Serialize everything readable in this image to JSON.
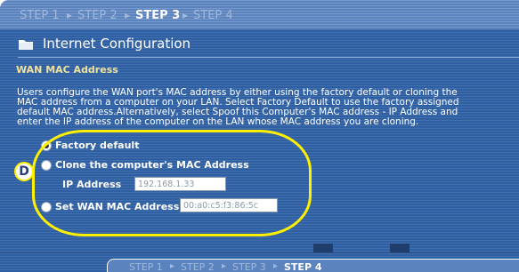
{
  "wizard": {
    "steps": [
      {
        "label": "STEP 1",
        "active": false
      },
      {
        "label": "STEP 2",
        "active": false
      },
      {
        "label": "STEP 3",
        "active": true
      },
      {
        "label": "STEP 4",
        "active": false
      }
    ],
    "separator": "▸"
  },
  "header": {
    "title": "Internet Configuration",
    "icon": "folder-icon"
  },
  "section": {
    "title": "WAN MAC Address"
  },
  "description": {
    "lines": [
      "Users configure the WAN port's MAC address by either using the factory default or cloning the",
      "MAC address from a computer on your LAN. Select Factory Default to use the factory assigned",
      "default MAC address.Alternatively, select Spoof this Computer's MAC address - IP Address and",
      "enter the IP address of the computer on the LAN whose MAC address you are cloning."
    ]
  },
  "options": {
    "factory_default": {
      "label": "Factory default",
      "selected": true
    },
    "clone": {
      "label": "Clone the computer's MAC Address",
      "selected": false
    },
    "ip_address": {
      "label": "IP Address",
      "value": "192.168.1.33"
    },
    "set_wan": {
      "label": "Set WAN MAC Address",
      "value": "00:a0:c5:f3:86:5c",
      "selected": false
    }
  },
  "callout": {
    "letter": "D",
    "color": "#ffef00"
  },
  "next_screen": {
    "steps": [
      "STEP 1",
      "STEP 2",
      "STEP 3",
      "STEP 4"
    ]
  },
  "colors": {
    "panel": "#2e5fa3",
    "step_bar": "#5b83bd",
    "section_title": "#f0e29a"
  }
}
